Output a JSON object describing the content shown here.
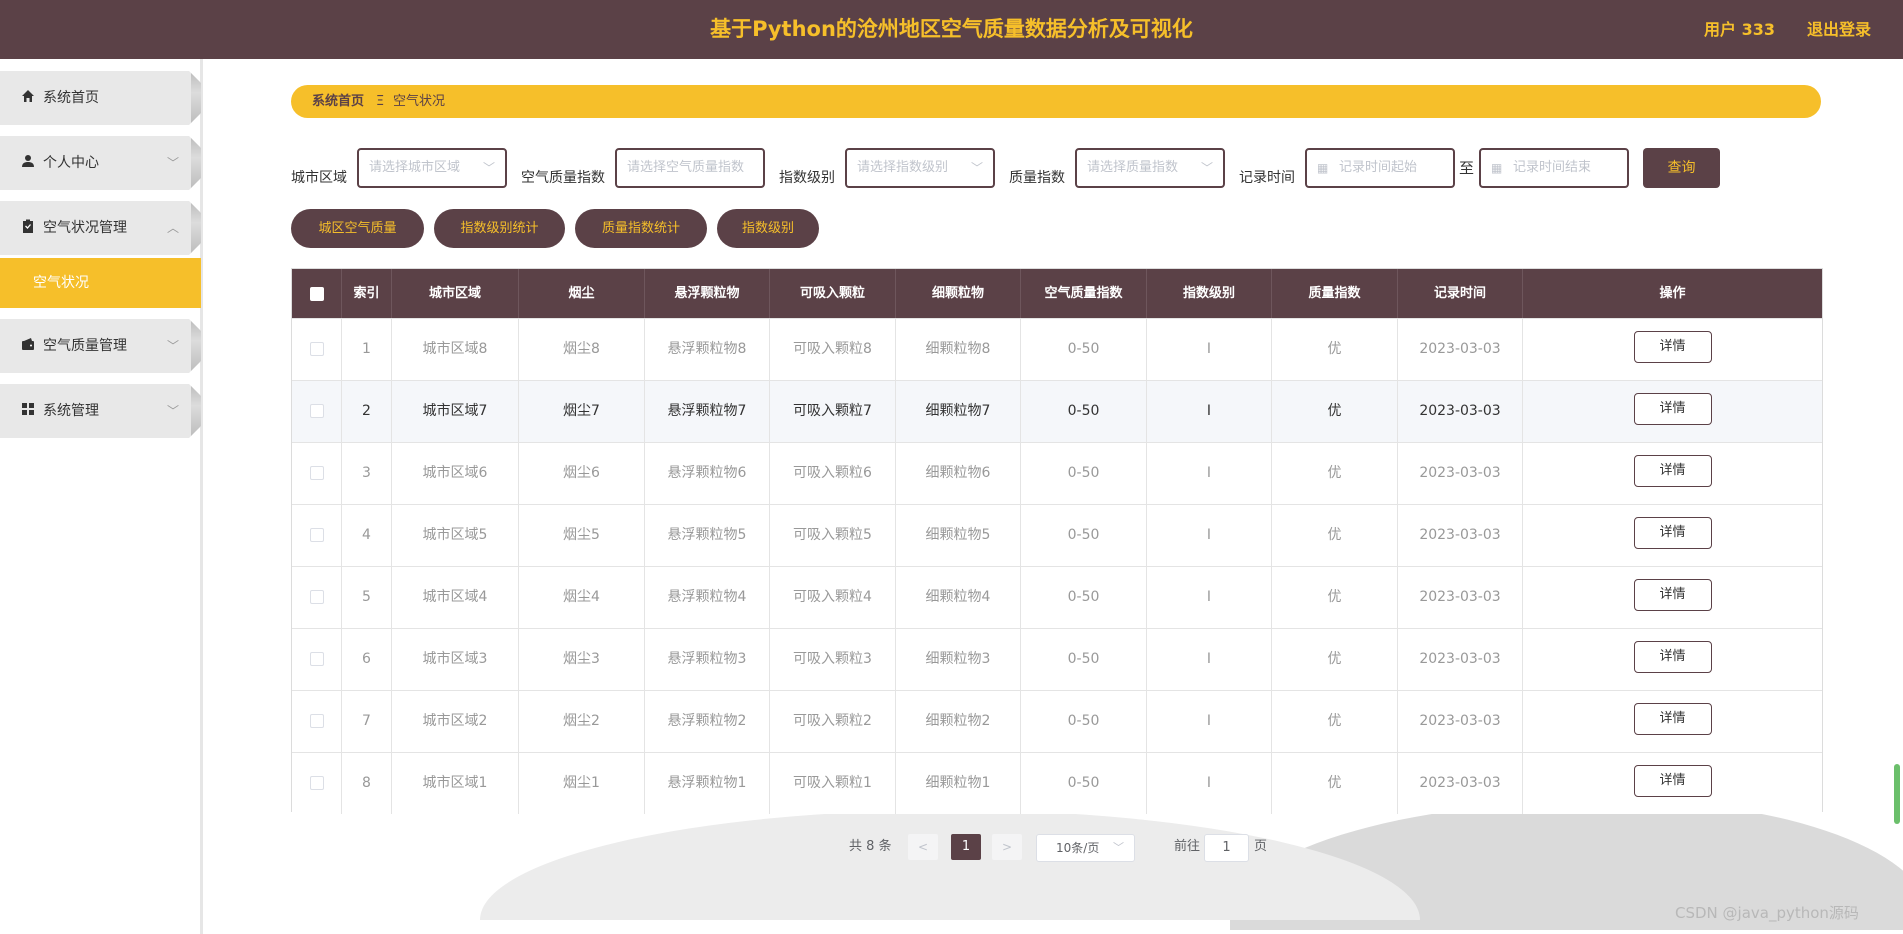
{
  "header": {
    "title": "基于Python的沧州地区空气质量数据分析及可视化",
    "user": "用户 333",
    "logout": "退出登录"
  },
  "sidebar": {
    "items": [
      {
        "label": "系统首页",
        "icon": "home-icon",
        "chevron": ""
      },
      {
        "label": "个人中心",
        "icon": "user-icon",
        "chevron": "﹀"
      },
      {
        "label": "空气状况管理",
        "icon": "clipboard-icon",
        "chevron": "︿"
      },
      {
        "label": "空气质量管理",
        "icon": "wallet-icon",
        "chevron": "﹀"
      },
      {
        "label": "系统管理",
        "icon": "grid-icon",
        "chevron": "﹀"
      }
    ],
    "active_sub": "空气状况"
  },
  "breadcrumb": {
    "home": "系统首页",
    "sep": "Ξ",
    "current": "空气状况"
  },
  "filters": {
    "city_label": "城市区域",
    "city_placeholder": "请选择城市区域",
    "aqi_label": "空气质量指数",
    "aqi_placeholder": "请选择空气质量指数",
    "level_label": "指数级别",
    "level_placeholder": "请选择指数级别",
    "quality_label": "质量指数",
    "quality_placeholder": "请选择质量指数",
    "time_label": "记录时间",
    "time_start_placeholder": "记录时间起始",
    "to_label": "至",
    "time_end_placeholder": "记录时间结束",
    "query_label": "查询"
  },
  "actions": [
    "城区空气质量",
    "指数级别统计",
    "质量指数统计",
    "指数级别"
  ],
  "table": {
    "headers": [
      "索引",
      "城市区域",
      "烟尘",
      "悬浮颗粒物",
      "可吸入颗粒",
      "细颗粒物",
      "空气质量指数",
      "指数级别",
      "质量指数",
      "记录时间",
      "操作"
    ],
    "rows": [
      [
        "1",
        "城市区域8",
        "烟尘8",
        "悬浮颗粒物8",
        "可吸入颗粒8",
        "细颗粒物8",
        "0-50",
        "I",
        "优",
        "2023-03-03"
      ],
      [
        "2",
        "城市区域7",
        "烟尘7",
        "悬浮颗粒物7",
        "可吸入颗粒7",
        "细颗粒物7",
        "0-50",
        "I",
        "优",
        "2023-03-03"
      ],
      [
        "3",
        "城市区域6",
        "烟尘6",
        "悬浮颗粒物6",
        "可吸入颗粒6",
        "细颗粒物6",
        "0-50",
        "I",
        "优",
        "2023-03-03"
      ],
      [
        "4",
        "城市区域5",
        "烟尘5",
        "悬浮颗粒物5",
        "可吸入颗粒5",
        "细颗粒物5",
        "0-50",
        "I",
        "优",
        "2023-03-03"
      ],
      [
        "5",
        "城市区域4",
        "烟尘4",
        "悬浮颗粒物4",
        "可吸入颗粒4",
        "细颗粒物4",
        "0-50",
        "I",
        "优",
        "2023-03-03"
      ],
      [
        "6",
        "城市区域3",
        "烟尘3",
        "悬浮颗粒物3",
        "可吸入颗粒3",
        "细颗粒物3",
        "0-50",
        "I",
        "优",
        "2023-03-03"
      ],
      [
        "7",
        "城市区域2",
        "烟尘2",
        "悬浮颗粒物2",
        "可吸入颗粒2",
        "细颗粒物2",
        "0-50",
        "I",
        "优",
        "2023-03-03"
      ],
      [
        "8",
        "城市区域1",
        "烟尘1",
        "悬浮颗粒物1",
        "可吸入颗粒1",
        "细颗粒物1",
        "0-50",
        "I",
        "优",
        "2023-03-03"
      ]
    ],
    "detail_label": "详情"
  },
  "pagination": {
    "total": "共 8 条",
    "prev": "<",
    "page": "1",
    "next": ">",
    "page_size": "10条/页",
    "goto_label": "前往",
    "goto_value": "1",
    "unit": "页"
  },
  "watermark": "CSDN @java_python源码",
  "colors": {
    "primary": "#5b4147",
    "accent": "#f6bf2a"
  }
}
